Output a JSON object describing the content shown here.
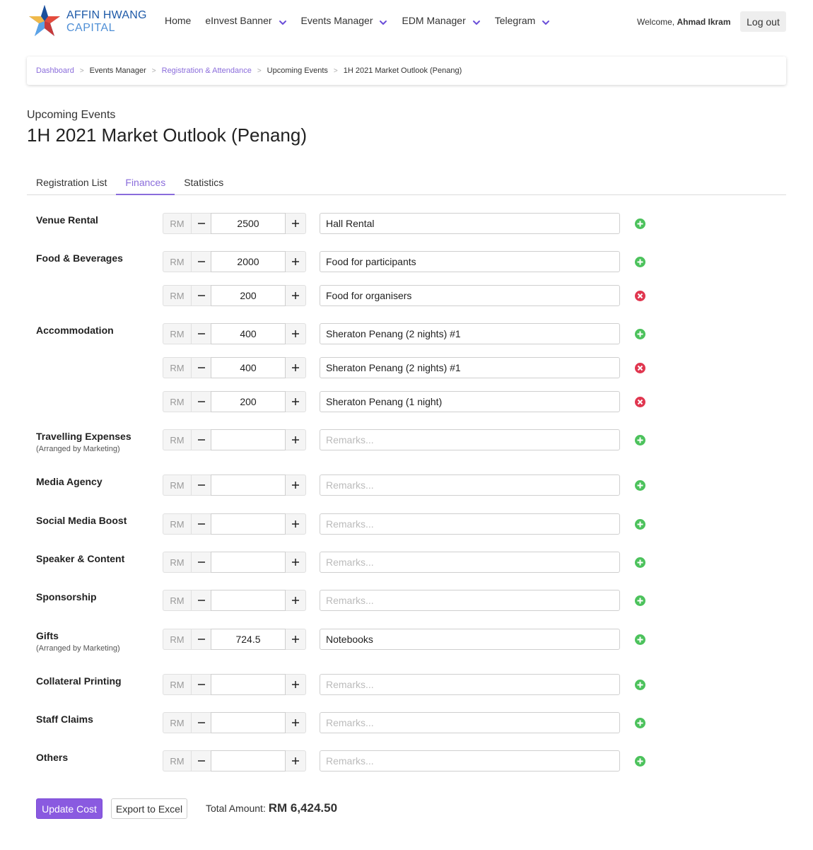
{
  "brand": {
    "line1": "AFFIN HWANG",
    "line2": "CAPITAL",
    "logo_icon": "star-logo-icon"
  },
  "nav": {
    "items": [
      {
        "label": "Home",
        "dropdown": false
      },
      {
        "label": "eInvest Banner",
        "dropdown": true
      },
      {
        "label": "Events Manager",
        "dropdown": true
      },
      {
        "label": "EDM Manager",
        "dropdown": true
      },
      {
        "label": "Telegram",
        "dropdown": true
      }
    ],
    "welcome_prefix": "Welcome,",
    "user_name": "Ahmad Ikram",
    "logout_label": "Log out",
    "accent": "#6b4fd8"
  },
  "breadcrumb": [
    {
      "label": "Dashboard",
      "link": true
    },
    {
      "label": "Events Manager",
      "link": false
    },
    {
      "label": "Registration & Attendance",
      "link": true
    },
    {
      "label": "Upcoming Events",
      "link": false
    },
    {
      "label": "1H 2021 Market Outlook (Penang)",
      "link": false
    }
  ],
  "breadcrumb_separator": ">",
  "page": {
    "subtitle": "Upcoming Events",
    "title": "1H 2021 Market Outlook (Penang)"
  },
  "tabs": [
    {
      "label": "Registration List",
      "active": false
    },
    {
      "label": "Finances",
      "active": true
    },
    {
      "label": "Statistics",
      "active": false
    }
  ],
  "currency": "RM",
  "remarks_placeholder": "Remarks...",
  "finance_rows": [
    {
      "category": "Venue Rental",
      "note": "",
      "amount": "2500",
      "remarks": "Hall Rental",
      "action": "add"
    },
    {
      "category": "Food & Beverages",
      "note": "",
      "amount": "2000",
      "remarks": "Food for participants",
      "action": "add"
    },
    {
      "category": "",
      "note": "",
      "amount": "200",
      "remarks": "Food for organisers",
      "action": "remove"
    },
    {
      "category": "Accommodation",
      "note": "",
      "amount": "400",
      "remarks": "Sheraton Penang (2 nights) #1",
      "action": "add"
    },
    {
      "category": "",
      "note": "",
      "amount": "400",
      "remarks": "Sheraton Penang (2 nights) #1",
      "action": "remove"
    },
    {
      "category": "",
      "note": "",
      "amount": "200",
      "remarks": "Sheraton Penang (1 night)",
      "action": "remove"
    },
    {
      "category": "Travelling Expenses",
      "note": "(Arranged by Marketing)",
      "amount": "",
      "remarks": "",
      "action": "add"
    },
    {
      "category": "Media Agency",
      "note": "",
      "amount": "",
      "remarks": "",
      "action": "add"
    },
    {
      "category": "Social Media Boost",
      "note": "",
      "amount": "",
      "remarks": "",
      "action": "add"
    },
    {
      "category": "Speaker & Content",
      "note": "",
      "amount": "",
      "remarks": "",
      "action": "add"
    },
    {
      "category": "Sponsorship",
      "note": "",
      "amount": "",
      "remarks": "",
      "action": "add"
    },
    {
      "category": "Gifts",
      "note": "(Arranged by Marketing)",
      "amount": "724.5",
      "remarks": "Notebooks",
      "action": "add"
    },
    {
      "category": "Collateral Printing",
      "note": "",
      "amount": "",
      "remarks": "",
      "action": "add"
    },
    {
      "category": "Staff Claims",
      "note": "",
      "amount": "",
      "remarks": "",
      "action": "add"
    },
    {
      "category": "Others",
      "note": "",
      "amount": "",
      "remarks": "",
      "action": "add"
    }
  ],
  "footer": {
    "update_label": "Update Cost",
    "export_label": "Export to Excel",
    "total_label": "Total Amount:",
    "total_value": "RM 6,424.50"
  },
  "colors": {
    "add": "#4cc25c",
    "remove": "#e0364f",
    "primary_button": "#8a5ae0",
    "link": "#8a6cdb"
  }
}
